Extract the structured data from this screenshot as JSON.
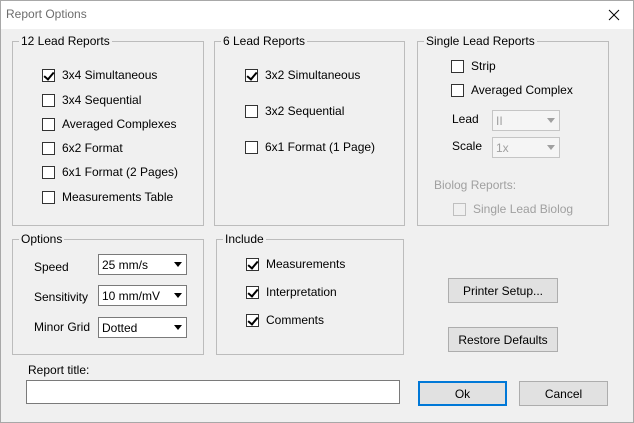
{
  "window": {
    "title": "Report Options"
  },
  "icons": {
    "close": "close-icon",
    "dropdown": "chevron-down-icon",
    "check": "check-icon"
  },
  "twelve_lead": {
    "legend": "12 Lead Reports",
    "items": [
      {
        "label": "3x4 Simultaneous",
        "checked": true
      },
      {
        "label": "3x4 Sequential",
        "checked": false
      },
      {
        "label": "Averaged Complexes",
        "checked": false
      },
      {
        "label": "6x2 Format",
        "checked": false
      },
      {
        "label": "6x1 Format (2 Pages)",
        "checked": false
      },
      {
        "label": "Measurements Table",
        "checked": false
      }
    ]
  },
  "six_lead": {
    "legend": "6 Lead Reports",
    "items": [
      {
        "label": "3x2 Simultaneous",
        "checked": true
      },
      {
        "label": "3x2 Sequential",
        "checked": false
      },
      {
        "label": "6x1 Format (1 Page)",
        "checked": false
      }
    ]
  },
  "single_lead": {
    "legend": "Single Lead Reports",
    "strip_label": "Strip",
    "averaged_label": "Averaged Complex",
    "lead_label": "Lead",
    "lead_value": "II",
    "scale_label": "Scale",
    "scale_value": "1x",
    "biolog_label": "Biolog Reports:",
    "biolog_item": "Single Lead Biolog"
  },
  "options": {
    "legend": "Options",
    "speed_label": "Speed",
    "speed_value": "25 mm/s",
    "sensitivity_label": "Sensitivity",
    "sensitivity_value": "10 mm/mV",
    "grid_label": "Minor Grid",
    "grid_value": "Dotted"
  },
  "include": {
    "legend": "Include",
    "items": [
      {
        "label": "Measurements",
        "checked": true
      },
      {
        "label": "Interpretation",
        "checked": true
      },
      {
        "label": "Comments",
        "checked": true
      }
    ]
  },
  "buttons": {
    "printer_setup": "Printer Setup...",
    "restore_defaults": "Restore Defaults",
    "ok": "Ok",
    "cancel": "Cancel"
  },
  "report_title": {
    "label": "Report title:",
    "value": ""
  }
}
